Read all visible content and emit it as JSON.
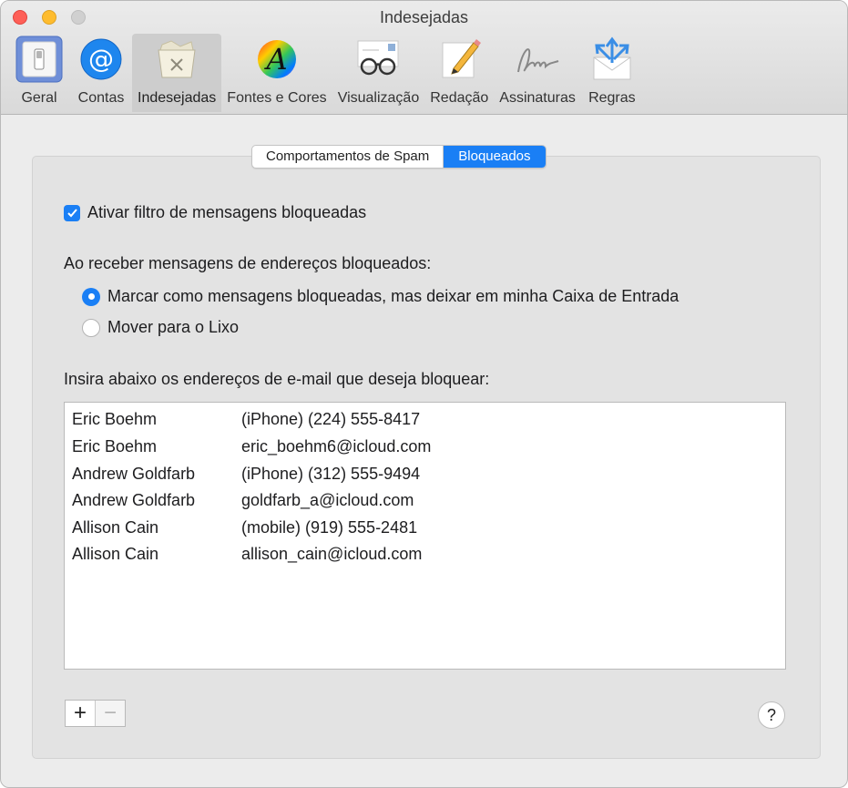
{
  "window": {
    "title": "Indesejadas"
  },
  "toolbar": {
    "items": [
      {
        "label": "Geral",
        "icon": "switch-icon"
      },
      {
        "label": "Contas",
        "icon": "at-sign-icon"
      },
      {
        "label": "Indesejadas",
        "icon": "junk-tray-icon"
      },
      {
        "label": "Fontes e Cores",
        "icon": "font-color-icon"
      },
      {
        "label": "Visualização",
        "icon": "glasses-icon"
      },
      {
        "label": "Redação",
        "icon": "pencil-paper-icon"
      },
      {
        "label": "Assinaturas",
        "icon": "signature-icon"
      },
      {
        "label": "Regras",
        "icon": "envelope-arrows-icon"
      }
    ],
    "selected": "Indesejadas"
  },
  "tabs": {
    "spam": "Comportamentos de Spam",
    "blocked": "Bloqueados",
    "selected": "Bloqueados"
  },
  "options": {
    "enable_filter": {
      "label": "Ativar filtro de mensagens bloqueadas",
      "checked": true
    },
    "receive_heading": "Ao receber mensagens de endereços bloqueados:",
    "radio_mark": {
      "label": "Marcar como mensagens bloqueadas, mas deixar em minha Caixa de Entrada",
      "selected": true
    },
    "radio_trash": {
      "label": "Mover para o Lixo",
      "selected": false
    },
    "list_heading": "Insira abaixo os endereços de e-mail que deseja bloquear:"
  },
  "blocked_list": [
    {
      "name": "Eric Boehm",
      "address": "(iPhone) (224) 555-8417"
    },
    {
      "name": "Eric Boehm",
      "address": "eric_boehm6@icloud.com"
    },
    {
      "name": "Andrew Goldfarb",
      "address": "(iPhone) (312) 555-9494"
    },
    {
      "name": "Andrew Goldfarb",
      "address": "goldfarb_a@icloud.com"
    },
    {
      "name": "Allison Cain",
      "address": "(mobile) (919) 555-2481"
    },
    {
      "name": "Allison Cain",
      "address": "allison_cain@icloud.com"
    }
  ],
  "buttons": {
    "add": "+",
    "remove": "−",
    "help": "?"
  },
  "colors": {
    "accent": "#1a7ff5",
    "close": "#fe5f57",
    "minimize": "#febc2e"
  }
}
